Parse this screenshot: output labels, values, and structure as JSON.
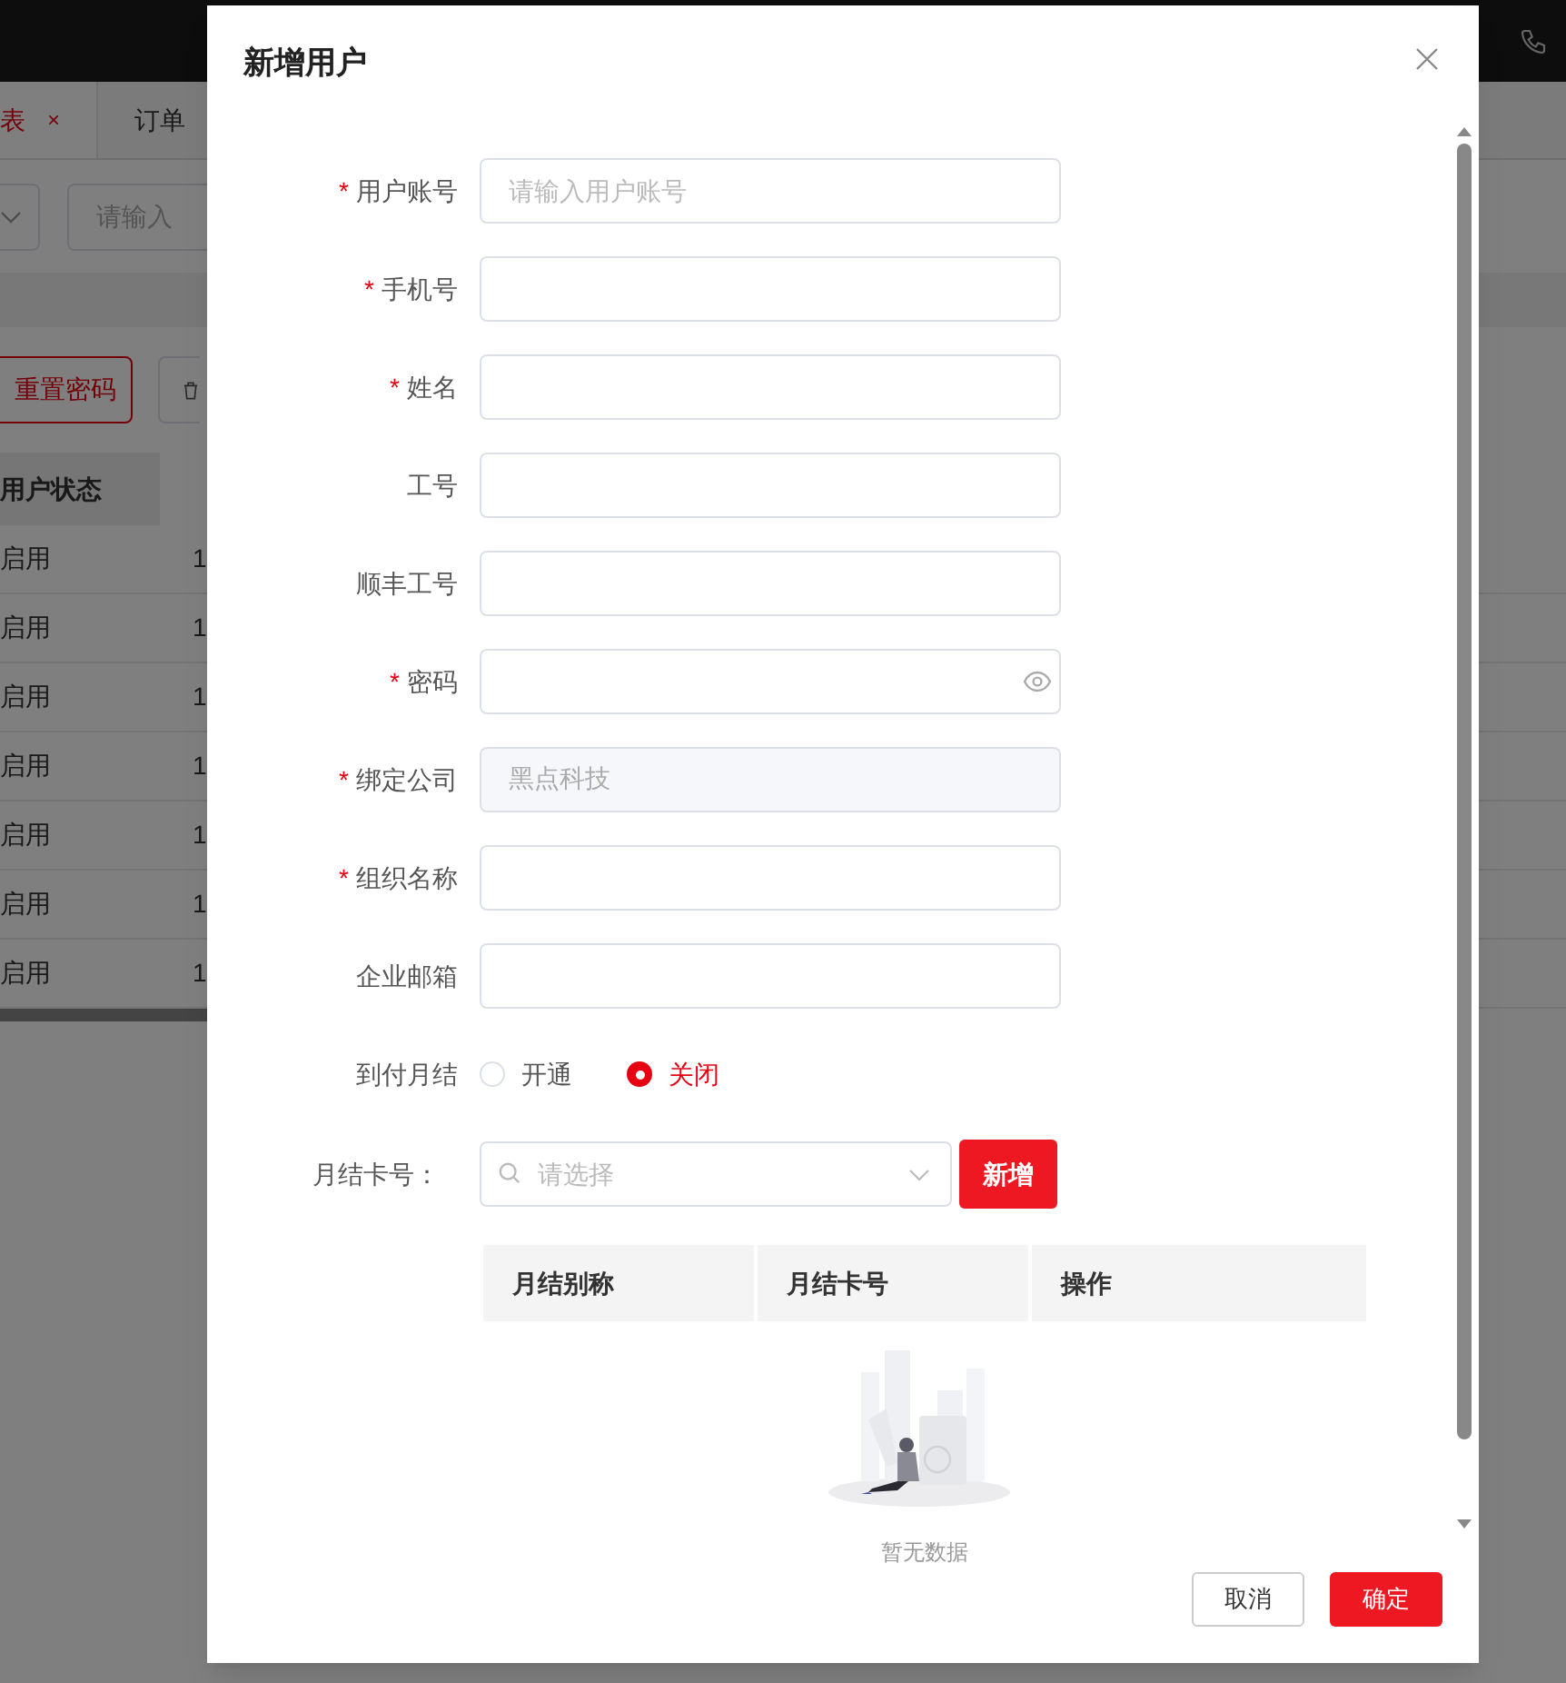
{
  "background": {
    "tabs": [
      {
        "label": "表",
        "selected": true,
        "close": "×"
      },
      {
        "label": "订单",
        "selected": false
      }
    ],
    "filter": {
      "placeholder": "请输入"
    },
    "reset_button": "重置密码",
    "table": {
      "columns": [
        "用户状态"
      ],
      "rows": [
        [
          "启用",
          "1"
        ],
        [
          "启用",
          "1"
        ],
        [
          "启用",
          "1"
        ],
        [
          "启用",
          "1"
        ],
        [
          "启用",
          "1"
        ],
        [
          "启用",
          "1"
        ],
        [
          "启用",
          "1"
        ]
      ]
    }
  },
  "dialog": {
    "title": "新增用户",
    "fields": [
      {
        "label": "用户账号",
        "required_mark": "*",
        "kind": "text",
        "placeholder": "请输入用户账号"
      },
      {
        "label": "手机号",
        "required_mark": "*",
        "kind": "text"
      },
      {
        "label": "姓名",
        "required_mark": "*",
        "kind": "text"
      },
      {
        "label": "工号",
        "kind": "text"
      },
      {
        "label": "顺丰工号",
        "kind": "text"
      },
      {
        "label": "密码",
        "required_mark": "*",
        "kind": "password"
      },
      {
        "label": "绑定公司",
        "required_mark": "*",
        "kind": "text",
        "value": "黑点科技",
        "disabled": true
      },
      {
        "label": "组织名称",
        "required_mark": "*",
        "kind": "text"
      },
      {
        "label": "企业邮箱",
        "kind": "text"
      }
    ],
    "payment": {
      "label": "到付月结",
      "options": [
        {
          "label": "开通",
          "selected": false
        },
        {
          "label": "关闭",
          "selected": true
        }
      ]
    },
    "card": {
      "label": "月结卡号：",
      "placeholder": "请选择",
      "add_button": "新增"
    },
    "card_table": {
      "columns": [
        "月结别称",
        "月结卡号",
        "操作"
      ],
      "empty_text": "暂无数据"
    },
    "footer": {
      "cancel": "取消",
      "confirm": "确定"
    }
  }
}
